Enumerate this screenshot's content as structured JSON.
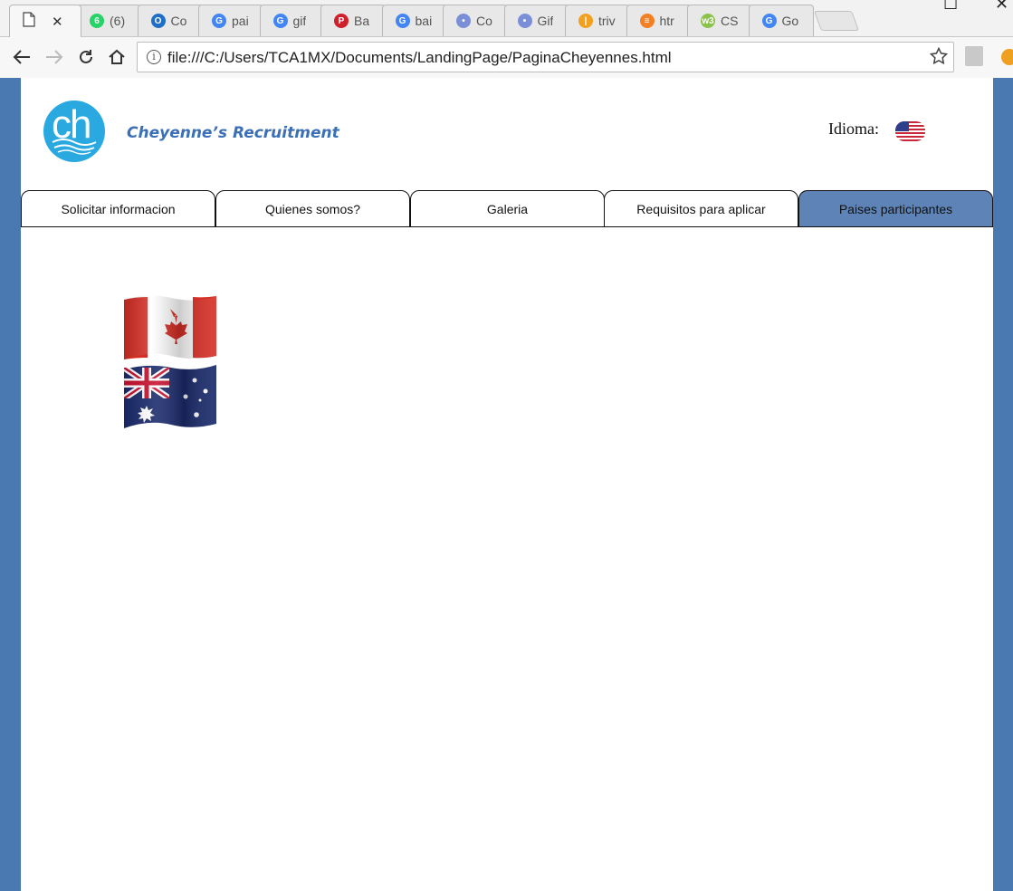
{
  "browser": {
    "tabs": [
      {
        "label": "",
        "icon": "document-icon",
        "active": true
      },
      {
        "label": "(6)",
        "icon": "whatsapp-icon",
        "color": "#25d366",
        "glyph": "6"
      },
      {
        "label": "Co",
        "icon": "outlook-icon",
        "color": "#1e6ec8",
        "glyph": "O"
      },
      {
        "label": "pai",
        "icon": "google-icon",
        "color": "#4285f4",
        "glyph": "G"
      },
      {
        "label": "gif",
        "icon": "google-icon",
        "color": "#4285f4",
        "glyph": "G"
      },
      {
        "label": "Ba",
        "icon": "pinterest-icon",
        "color": "#d0202b",
        "glyph": "P"
      },
      {
        "label": "bai",
        "icon": "google-icon",
        "color": "#4285f4",
        "glyph": "G"
      },
      {
        "label": "Co",
        "icon": "bookmark-app-icon",
        "color": "#7a8fd8",
        "glyph": "•"
      },
      {
        "label": "Gif",
        "icon": "bookmark-app-icon",
        "color": "#7a8fd8",
        "glyph": "•"
      },
      {
        "label": "triv",
        "icon": "trivia-icon",
        "color": "#f2a020",
        "glyph": "|"
      },
      {
        "label": "htr",
        "icon": "stackoverflow-icon",
        "color": "#f48024",
        "glyph": "≡"
      },
      {
        "label": "CS",
        "icon": "w3schools-icon",
        "color": "#8bc34a",
        "glyph": "w3"
      },
      {
        "label": "Go",
        "icon": "google-icon",
        "color": "#4285f4",
        "glyph": "G"
      }
    ],
    "url": "file:///C:/Users/TCA1MX/Documents/LandingPage/PaginaCheyennes.html"
  },
  "header": {
    "logo_text": "ch",
    "brand": "Cheyenne’s Recruitment",
    "language_label": "Idioma:",
    "language_flag": "us-flag-icon"
  },
  "nav": {
    "tabs": [
      {
        "label": "Solicitar informacion",
        "selected": false
      },
      {
        "label": "Quienes somos?",
        "selected": false
      },
      {
        "label": "Galeria",
        "selected": false
      },
      {
        "label": "Requisitos para aplicar",
        "selected": false
      },
      {
        "label": "Paises participantes",
        "selected": true
      }
    ]
  },
  "countries": [
    {
      "name": "canada-flag-icon"
    },
    {
      "name": "australia-flag-icon"
    }
  ],
  "colors": {
    "viewport_border": "#4a78b0",
    "selected_tab": "#5d83b7",
    "brand": "#3b6fb6",
    "logo": "#29a9e0"
  }
}
